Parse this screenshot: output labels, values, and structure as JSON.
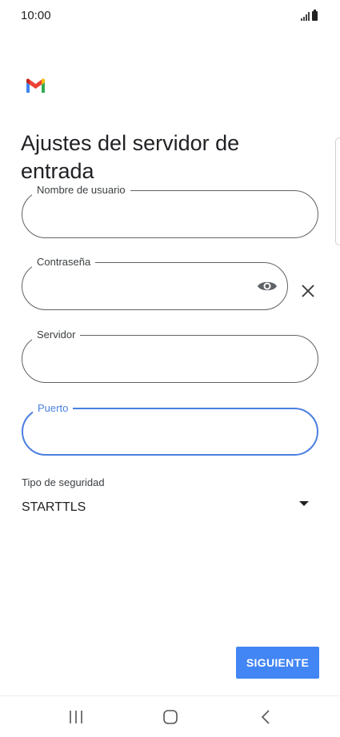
{
  "status_bar": {
    "time": "10:00"
  },
  "icons": {
    "app_logo": "gmail-logo-icon",
    "password_visibility": "eye-icon",
    "clear": "close-icon",
    "dropdown": "dropdown-arrow-icon",
    "nav_recents": "recent-apps-icon",
    "nav_home": "home-icon",
    "nav_back": "back-icon"
  },
  "title": "Ajustes del servidor de entrada",
  "fields": {
    "username": {
      "label": "Nombre de usuario",
      "value": ""
    },
    "password": {
      "label": "Contraseña",
      "value": ""
    },
    "server": {
      "label": "Servidor",
      "value": ""
    },
    "port": {
      "label": "Puerto",
      "value": ""
    }
  },
  "security": {
    "label": "Tipo de seguridad",
    "value": "STARTTLS"
  },
  "next_button": "SIGUIENTE",
  "colors": {
    "accent": "#4285f4",
    "focus": "#4a7fe0",
    "text": "#202124"
  }
}
